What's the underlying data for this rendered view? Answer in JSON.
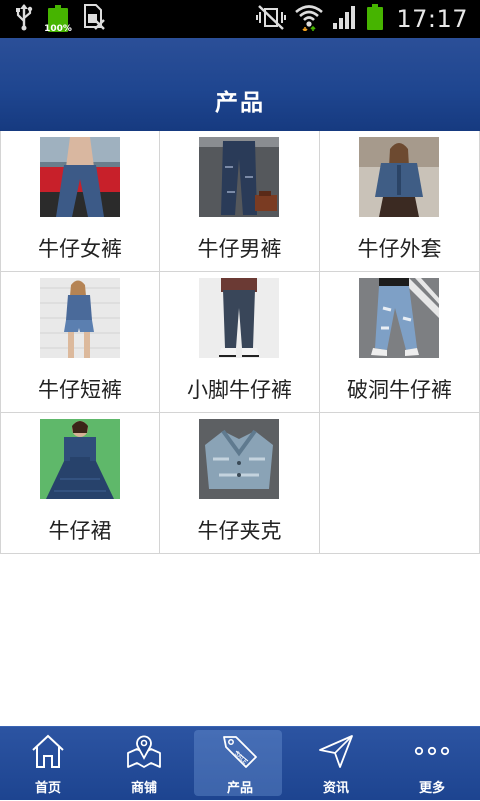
{
  "status_bar": {
    "battery_small_percent": "100%",
    "time": "17:17"
  },
  "header": {
    "title": "产品"
  },
  "products": [
    {
      "label": "牛仔女裤"
    },
    {
      "label": "牛仔男裤"
    },
    {
      "label": "牛仔外套"
    },
    {
      "label": "牛仔短裤"
    },
    {
      "label": "小脚牛仔裤"
    },
    {
      "label": "破洞牛仔裤"
    },
    {
      "label": "牛仔裙"
    },
    {
      "label": "牛仔夹克"
    }
  ],
  "tabbar": {
    "active": "products",
    "tabs": [
      {
        "label": "首页",
        "icon": "home-icon"
      },
      {
        "label": "商铺",
        "icon": "shop-map-icon"
      },
      {
        "label": "产品",
        "icon": "sale-tag-icon"
      },
      {
        "label": "资讯",
        "icon": "paper-plane-icon"
      },
      {
        "label": "更多",
        "icon": "more-dots-icon"
      }
    ]
  },
  "colors": {
    "header_bg": "#1f4690",
    "tabbar_bg": "#2c54a2",
    "battery_green": "#46b400"
  }
}
